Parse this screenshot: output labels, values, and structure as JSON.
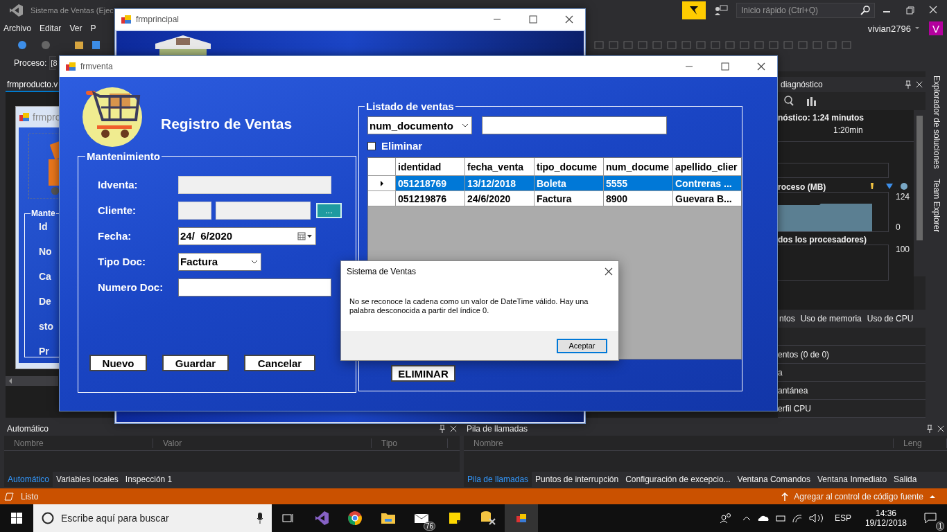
{
  "ide": {
    "title": "Sistema de Ventas (Ejec",
    "menu": [
      "Archivo",
      "Editar",
      "Ver",
      "P"
    ],
    "quick_launch": {
      "placeholder": "Inicio rápido (Ctrl+Q)"
    },
    "user": "vivian2796",
    "avatar_letter": "V",
    "process_label": "Proceso:",
    "process_value": "[8",
    "document_tab": "frmproducto.v"
  },
  "designer_form": {
    "title": "frmpro",
    "group": "Mante",
    "labels": [
      "Id",
      "No",
      "Ca",
      "De",
      "sto",
      "Pr"
    ]
  },
  "diagnostics": {
    "title": "diagnóstico",
    "session": "nóstico: 1:24 minutos",
    "time_tick": "1:20min",
    "memory_label": "roceso (MB)",
    "memory_max": "124",
    "memory_min": "0",
    "cpu_label": "dos los procesadores)",
    "cpu_max": "100",
    "tabs": [
      {
        "label": "ntos",
        "selected": false
      },
      {
        "label": "Uso de memoria",
        "selected": false
      },
      {
        "label": "Uso de CPU",
        "selected": false
      }
    ],
    "rows": [
      "entos (0 de 0)",
      "a",
      "antánea",
      "erfil CPU"
    ]
  },
  "side_tabs": [
    "Explorador de soluciones",
    "Team Explorer"
  ],
  "autos_panel": {
    "title": "Automático",
    "columns": [
      "Nombre",
      "Valor",
      "Tipo"
    ],
    "tabs": [
      {
        "label": "Automático",
        "selected": true
      },
      {
        "label": "Variables locales",
        "selected": false
      },
      {
        "label": "Inspección 1",
        "selected": false
      }
    ]
  },
  "callstack_panel": {
    "title": "Pila de llamadas",
    "columns": [
      "Nombre",
      "Leng"
    ],
    "tabs": [
      {
        "label": "Pila de llamadas",
        "selected": true
      },
      {
        "label": "Puntos de interrupción",
        "selected": false
      },
      {
        "label": "Configuración de excepcio...",
        "selected": false
      },
      {
        "label": "Ventana Comandos",
        "selected": false
      },
      {
        "label": "Ventana Inmediato",
        "selected": false
      },
      {
        "label": "Salida",
        "selected": false
      }
    ]
  },
  "status_bar": {
    "text": "Listo",
    "source_control": "Agregar al control de código fuente"
  },
  "taskbar": {
    "search_placeholder": "Escribe aquí para buscar",
    "mail_badge": "76",
    "language": "ESP",
    "time": "14:36",
    "date": "19/12/2018",
    "notification_count": "1"
  },
  "frmprincipal": {
    "title": "frmprincipal"
  },
  "frmventa": {
    "title": "frmventa",
    "heading": "Registro de Ventas",
    "form_group": "Mantenimiento",
    "fields": [
      {
        "label": "Idventa:",
        "kind": "text",
        "disabled": true
      },
      {
        "label": "Cliente:",
        "kind": "lookup",
        "disabled": true,
        "button": "..."
      },
      {
        "label": "Fecha:",
        "kind": "date",
        "value": "24/  6/2020"
      },
      {
        "label": "Tipo Doc:",
        "kind": "combo",
        "value": "Factura"
      },
      {
        "label": "Numero Doc:",
        "kind": "text",
        "disabled": false
      }
    ],
    "buttons": [
      "Nuevo",
      "Guardar",
      "Cancelar"
    ],
    "list_group": "Listado de ventas",
    "filter_field": "num_documento",
    "delete_checkbox": {
      "label": "Eliminar",
      "checked": false
    },
    "grid": {
      "columns": [
        "identidad",
        "fecha_venta",
        "tipo_docume",
        "num_docume",
        "apellido_clier"
      ],
      "rows": [
        {
          "selected": true,
          "cells": [
            "051218769",
            "13/12/2018",
            "Boleta",
            "5555",
            "Contreras ..."
          ]
        },
        {
          "selected": false,
          "cells": [
            "051219876",
            "24/6/2020",
            "Factura",
            "8900",
            "Guevara B..."
          ]
        }
      ]
    },
    "delete_button": "ELIMINAR"
  },
  "dialog": {
    "title": "Sistema de Ventas",
    "message": "No se reconoce la cadena como un valor de DateTime válido. Hay una palabra desconocida a partir del índice 0.",
    "button": "Aceptar"
  }
}
